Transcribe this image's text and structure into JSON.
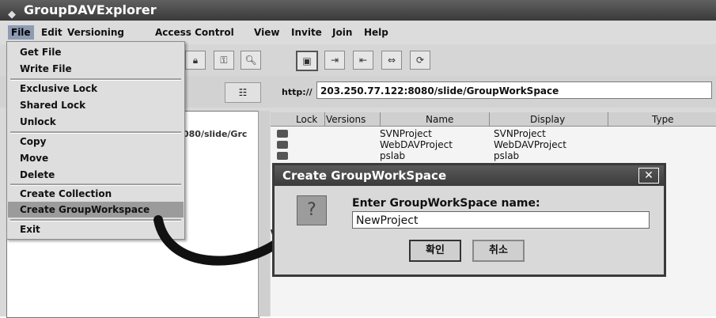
{
  "window": {
    "title": "GroupDAVExplorer"
  },
  "menubar": [
    "File",
    "Edit",
    "Versioning",
    "Access Control",
    "View",
    "Invite",
    "Join",
    "Help"
  ],
  "file_menu": {
    "items": [
      "Get File",
      "Write File",
      "Exclusive Lock",
      "Shared Lock",
      "Unlock",
      "Copy",
      "Move",
      "Delete",
      "Create Collection",
      "Create GroupWorkspace",
      "Exit"
    ],
    "highlighted": "Create GroupWorkspace"
  },
  "url": {
    "label": "http://",
    "value": "203.250.77.122:8080/slide/GroupWorkSpace"
  },
  "tree": {
    "partial_path": "080/slide/Grc"
  },
  "table": {
    "headers": [
      "Lock",
      "Versions",
      "Name",
      "Display",
      "Type"
    ],
    "rows": [
      {
        "name": "SVNProject",
        "display": "SVNProject"
      },
      {
        "name": "WebDAVProject",
        "display": "WebDAVProject"
      },
      {
        "name": "pslab",
        "display": "pslab"
      }
    ]
  },
  "dialog": {
    "title": "Create GroupWorkSpace",
    "close_glyph": "✕",
    "prompt": "Enter GroupWorkSpace name:",
    "input_value": "NewProject",
    "ok_label": "확인",
    "cancel_label": "취소",
    "icon_glyph": "?"
  },
  "colors": {
    "titlebar": "#4a4a4a",
    "menu_highlight": "#9b9b9b"
  }
}
